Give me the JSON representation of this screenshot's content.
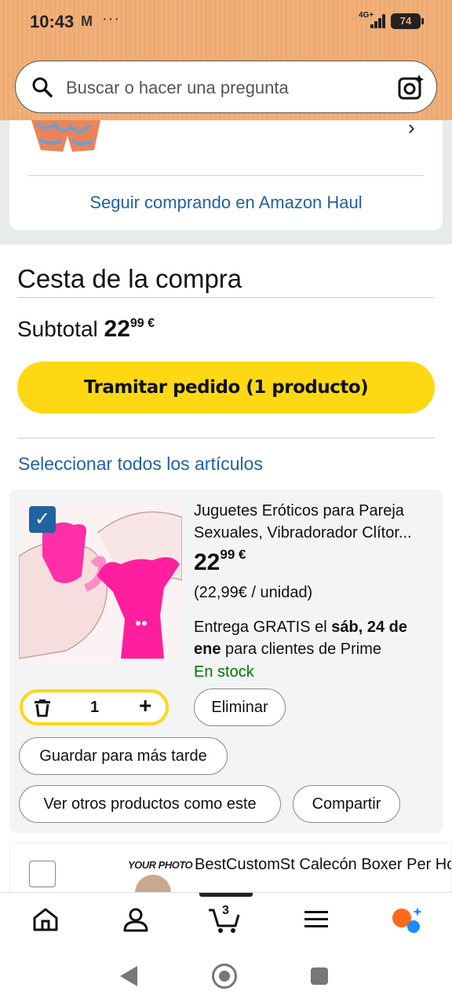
{
  "status_bar": {
    "time": "10:43",
    "notification_icon": "gmail-icon",
    "more": "···",
    "network": "4G+",
    "battery": "74"
  },
  "search": {
    "placeholder": "Buscar o hacer una pregunta"
  },
  "haul": {
    "link": "Seguir comprando en Amazon Haul"
  },
  "cart": {
    "title": "Cesta de la compra",
    "subtotal_label": "Subtotal",
    "subtotal_int": "22",
    "subtotal_dec": "99",
    "currency": "€",
    "checkout_label": "Tramitar pedido (1 producto)",
    "select_all": "Seleccionar todos los artículos"
  },
  "item1": {
    "checked": true,
    "title": "Juguetes Eróticos para Pareja Sexuales, Vibradorador Clítor...",
    "price_int": "22",
    "price_dec": "99",
    "currency": "€",
    "unit_price": "(22,99€ / unidad)",
    "delivery_prefix": "Entrega GRATIS el",
    "delivery_date": "sáb, 24 de ene",
    "delivery_suffix": "para clientes de Prime",
    "stock": "En stock",
    "quantity": "1",
    "buttons": {
      "eliminar": "Eliminar",
      "guardar": "Guardar para más tarde",
      "ver_otros": "Ver otros productos como este",
      "compartir": "Compartir"
    }
  },
  "item2": {
    "checked": false,
    "photo_label": "YOUR PHOTO",
    "title": "BestCustomSt Calecón Boxer Per Hombre, Slip Personalizado con F"
  },
  "bottom_nav": {
    "cart_count": "3",
    "items": [
      "home-icon",
      "account-icon",
      "cart-icon",
      "menu-icon",
      "rufus-icon"
    ]
  },
  "colors": {
    "accent_yellow": "#ffd814",
    "link_blue": "#2162a1",
    "stock_green": "#007600"
  }
}
